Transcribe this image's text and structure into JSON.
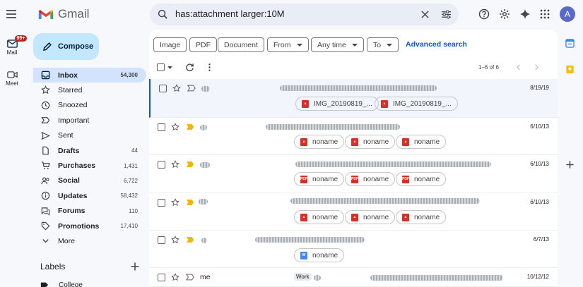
{
  "app": {
    "name": "Gmail"
  },
  "search": {
    "query": "has:attachment larger:10M"
  },
  "avatar": {
    "initial": "A",
    "color": "#5b6ac9"
  },
  "rail": {
    "mail": {
      "label": "Mail",
      "badge": "99+"
    },
    "meet": {
      "label": "Meet"
    }
  },
  "compose": {
    "label": "Compose"
  },
  "nav": {
    "items": [
      {
        "label": "Inbox",
        "count": "54,300",
        "bold": true,
        "active": true
      },
      {
        "label": "Starred",
        "count": ""
      },
      {
        "label": "Snoozed",
        "count": ""
      },
      {
        "label": "Important",
        "count": ""
      },
      {
        "label": "Sent",
        "count": ""
      },
      {
        "label": "Drafts",
        "count": "44",
        "bold": true
      },
      {
        "label": "Purchases",
        "count": "1,431",
        "bold": true
      },
      {
        "label": "Social",
        "count": "6,722",
        "bold": true
      },
      {
        "label": "Updates",
        "count": "58,432",
        "bold": true
      },
      {
        "label": "Forums",
        "count": "110",
        "bold": true
      },
      {
        "label": "Promotions",
        "count": "17,410",
        "bold": true
      },
      {
        "label": "More",
        "count": ""
      }
    ]
  },
  "labels": {
    "heading": "Labels",
    "items": [
      {
        "label": "College"
      }
    ]
  },
  "filters": {
    "image": "Image",
    "pdf": "PDF",
    "document": "Document",
    "from": "From",
    "any_time": "Any time",
    "to": "To",
    "advanced": "Advanced search"
  },
  "pager": {
    "text": "1–6 of 6"
  },
  "emails": [
    {
      "sender": "",
      "date": "8/19/19",
      "attachments": [
        "IMG_20190819_...",
        "IMG_20190819_..."
      ],
      "attachment_types": [
        "image",
        "image"
      ]
    },
    {
      "sender": "",
      "date": "6/10/13",
      "attachments": [
        "noname",
        "noname",
        "noname"
      ],
      "attachment_types": [
        "image",
        "image",
        "image"
      ]
    },
    {
      "sender": "",
      "date": "6/10/13",
      "attachments": [
        "noname",
        "noname",
        "noname"
      ],
      "attachment_types": [
        "pdf",
        "pdf",
        "pdf"
      ]
    },
    {
      "sender": "",
      "date": "6/10/13",
      "attachments": [
        "noname",
        "noname",
        "noname"
      ],
      "attachment_types": [
        "image",
        "image",
        "image"
      ]
    },
    {
      "sender": "",
      "date": "6/7/13",
      "attachments": [
        "noname"
      ],
      "attachment_types": [
        "word"
      ]
    },
    {
      "sender": "me",
      "date": "10/12/12",
      "tag": "Work",
      "attachments": [],
      "attachment_types": []
    }
  ],
  "colors": {
    "accent": "#0b57d0",
    "compose": "#c2e7ff",
    "active_nav": "#d3e3fd",
    "important": "#f4b400",
    "attachment_red": "#d93025",
    "word_blue": "#4285f4"
  }
}
